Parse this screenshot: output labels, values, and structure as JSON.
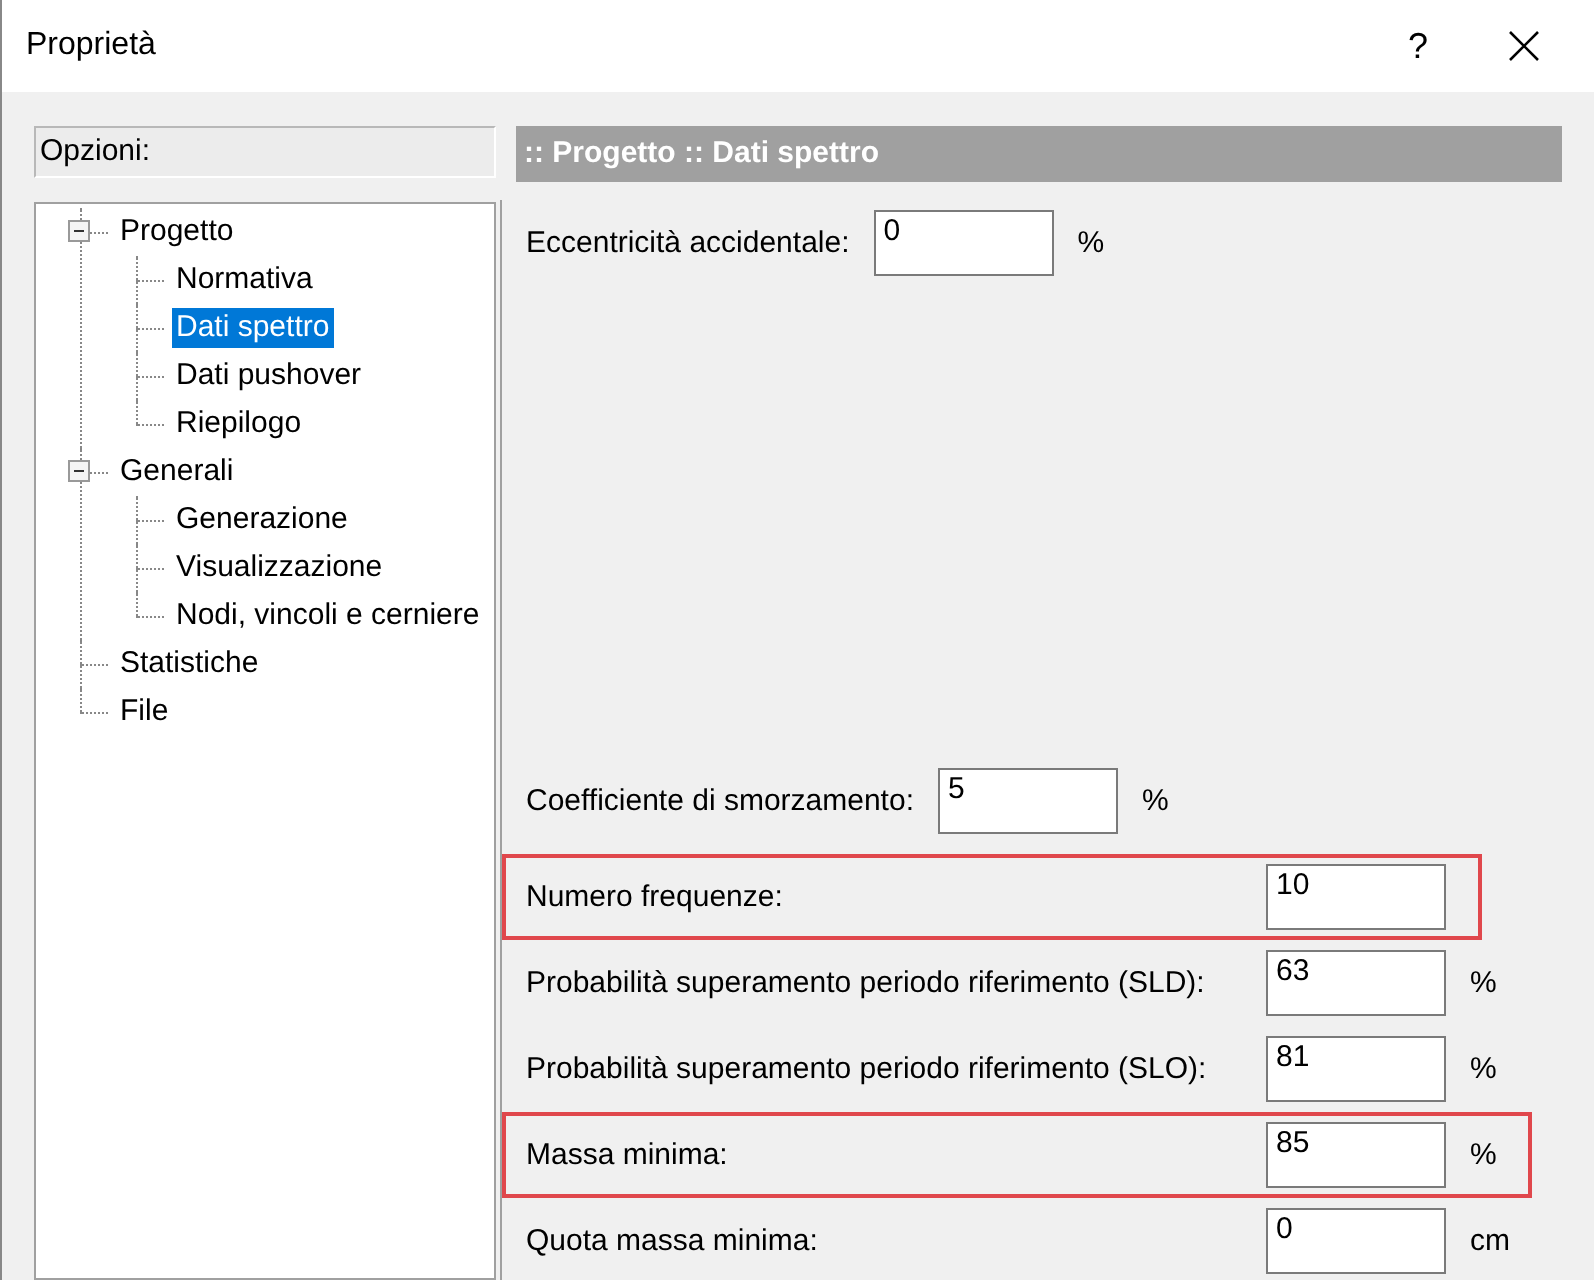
{
  "window": {
    "title": "Proprietà",
    "help": "?"
  },
  "options_label": "Opzioni:",
  "tree": [
    {
      "label": "Progetto",
      "expanded": true,
      "selected": false,
      "children": [
        {
          "label": "Normativa",
          "selected": false
        },
        {
          "label": "Dati spettro",
          "selected": true
        },
        {
          "label": "Dati pushover",
          "selected": false
        },
        {
          "label": "Riepilogo",
          "selected": false
        }
      ]
    },
    {
      "label": "Generali",
      "expanded": true,
      "selected": false,
      "children": [
        {
          "label": "Generazione",
          "selected": false
        },
        {
          "label": "Visualizzazione",
          "selected": false
        },
        {
          "label": "Nodi, vincoli e cerniere",
          "selected": false
        }
      ]
    },
    {
      "label": "Statistiche",
      "selected": false
    },
    {
      "label": "File",
      "selected": false
    }
  ],
  "header": ":: Progetto :: Dati spettro",
  "upper_fields": [
    {
      "kind": "inline",
      "label": "Eccentricità accidentale:",
      "value": "0",
      "unit": "%",
      "highlighted": false
    }
  ],
  "lower_fields": [
    {
      "kind": "inline",
      "label": "Coefficiente di smorzamento:",
      "value": "5",
      "unit": "%",
      "highlighted": false
    },
    {
      "kind": "aligned",
      "label": "Numero frequenze:",
      "value": "10",
      "highlighted": true
    },
    {
      "kind": "aligned",
      "label": "Probabilità superamento periodo riferimento (SLD):",
      "value": "63",
      "unit": "%",
      "highlighted": false
    },
    {
      "kind": "aligned",
      "label": "Probabilità superamento periodo riferimento (SLO):",
      "value": "81",
      "unit": "%",
      "highlighted": false
    },
    {
      "kind": "aligned",
      "label": "Massa minima:",
      "value": "85",
      "unit": "%",
      "highlighted": true
    },
    {
      "kind": "aligned",
      "label": "Quota massa minima:",
      "value": "0",
      "unit": "cm",
      "highlighted": false
    }
  ]
}
